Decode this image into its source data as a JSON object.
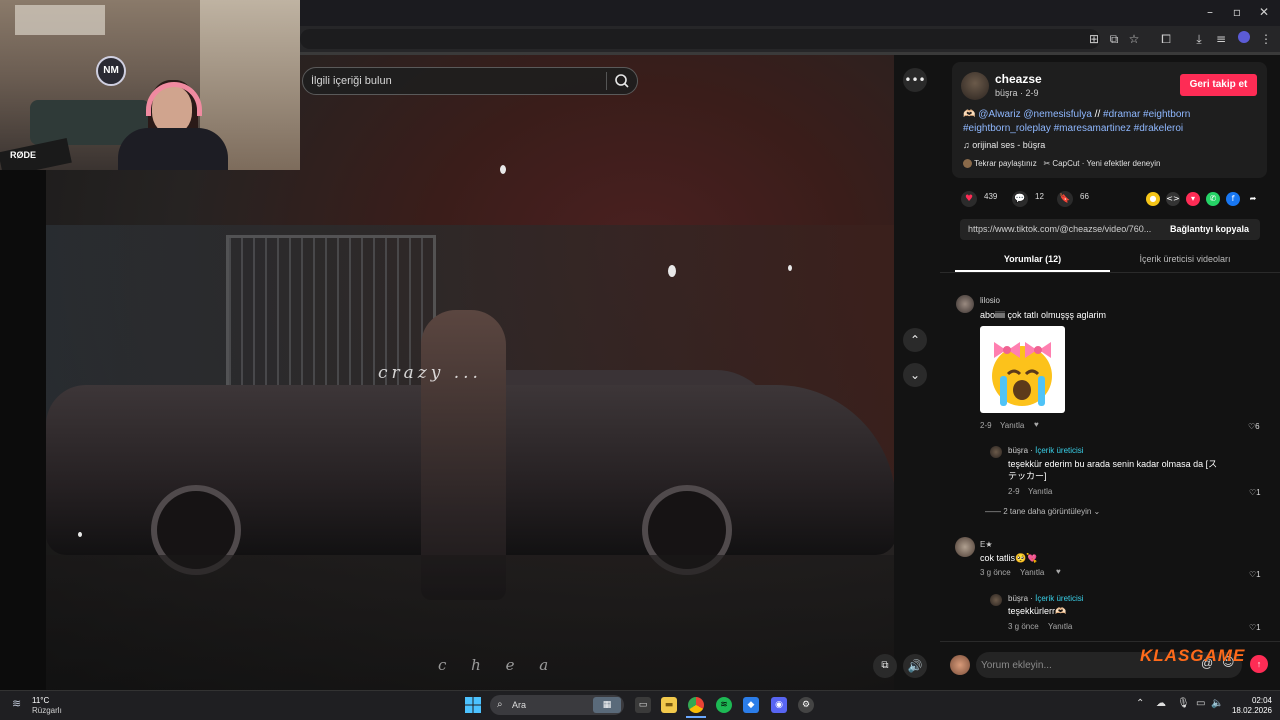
{
  "search": {
    "placeholder": "İlgili içeriği bulun"
  },
  "video": {
    "caption_top": "crazy ...",
    "caption_bottom": "c h e a"
  },
  "webcam": {
    "brand": "RØDE",
    "logo": "NM"
  },
  "post": {
    "creator": "cheazse",
    "subtitle": "büşra · 2-9",
    "follow_label": "Geri takip et",
    "desc_prefix": "🫶🏻 ",
    "mentions": "@Alwariz @nemesisfulya",
    "separator": " // ",
    "tags_line1": "#dramar #eightborn",
    "tags_line2": "#eightborn_roleplay #maresamartinez #drakeleroi",
    "sound": "orijinal ses - büşra",
    "repost": "Tekrar paylaştınız",
    "capcut": "CapCut · Yeni efektler deneyin",
    "likes": "439",
    "comments": "12",
    "saves": "66",
    "link": "https://www.tiktok.com/@cheazse/video/760...",
    "copy_label": "Bağlantıyı kopyala"
  },
  "tabs": {
    "comments": "Yorumlar (12)",
    "creator_videos": "İçerik üreticisi videoları"
  },
  "comments": [
    {
      "user": "lilosio",
      "text": "aboiiiii çok tatlı olmuşşş aglarim",
      "meta": "2-9",
      "reply": "Yanıtla",
      "likes": "6"
    },
    {
      "user": "büşra",
      "creator_label": "İçerik üreticisi",
      "text1": "teşekkür ederim bu arada senin kadar olmasa da [ス",
      "text2": "テッカー]",
      "meta": "2-9",
      "reply": "Yanıtla",
      "likes": "1"
    },
    {
      "more": "2 tane daha görüntüleyin"
    },
    {
      "user": "E★",
      "text": "cok tatlis🥺💘",
      "meta": "3 g önce",
      "reply": "Yanıtla",
      "likes": "1"
    },
    {
      "user": "büşra",
      "creator_label": "İçerik üreticisi",
      "text": "teşekkürlerr🫶🏻",
      "meta": "3 g önce",
      "reply": "Yanıtla",
      "likes": "1"
    }
  ],
  "comment_box": {
    "placeholder": "Yorum ekleyin..."
  },
  "watermark": "KLASGAME",
  "taskbar": {
    "temp": "11°C",
    "weather": "Rüzgarlı",
    "search_label": "Ara",
    "time": "02:04",
    "date": "18.02.2026"
  },
  "colors": {
    "accent": "#fe2c55",
    "tag": "#8fb8ff",
    "creator_tag": "#39d0e8",
    "watermark": "#ff6a1a"
  }
}
